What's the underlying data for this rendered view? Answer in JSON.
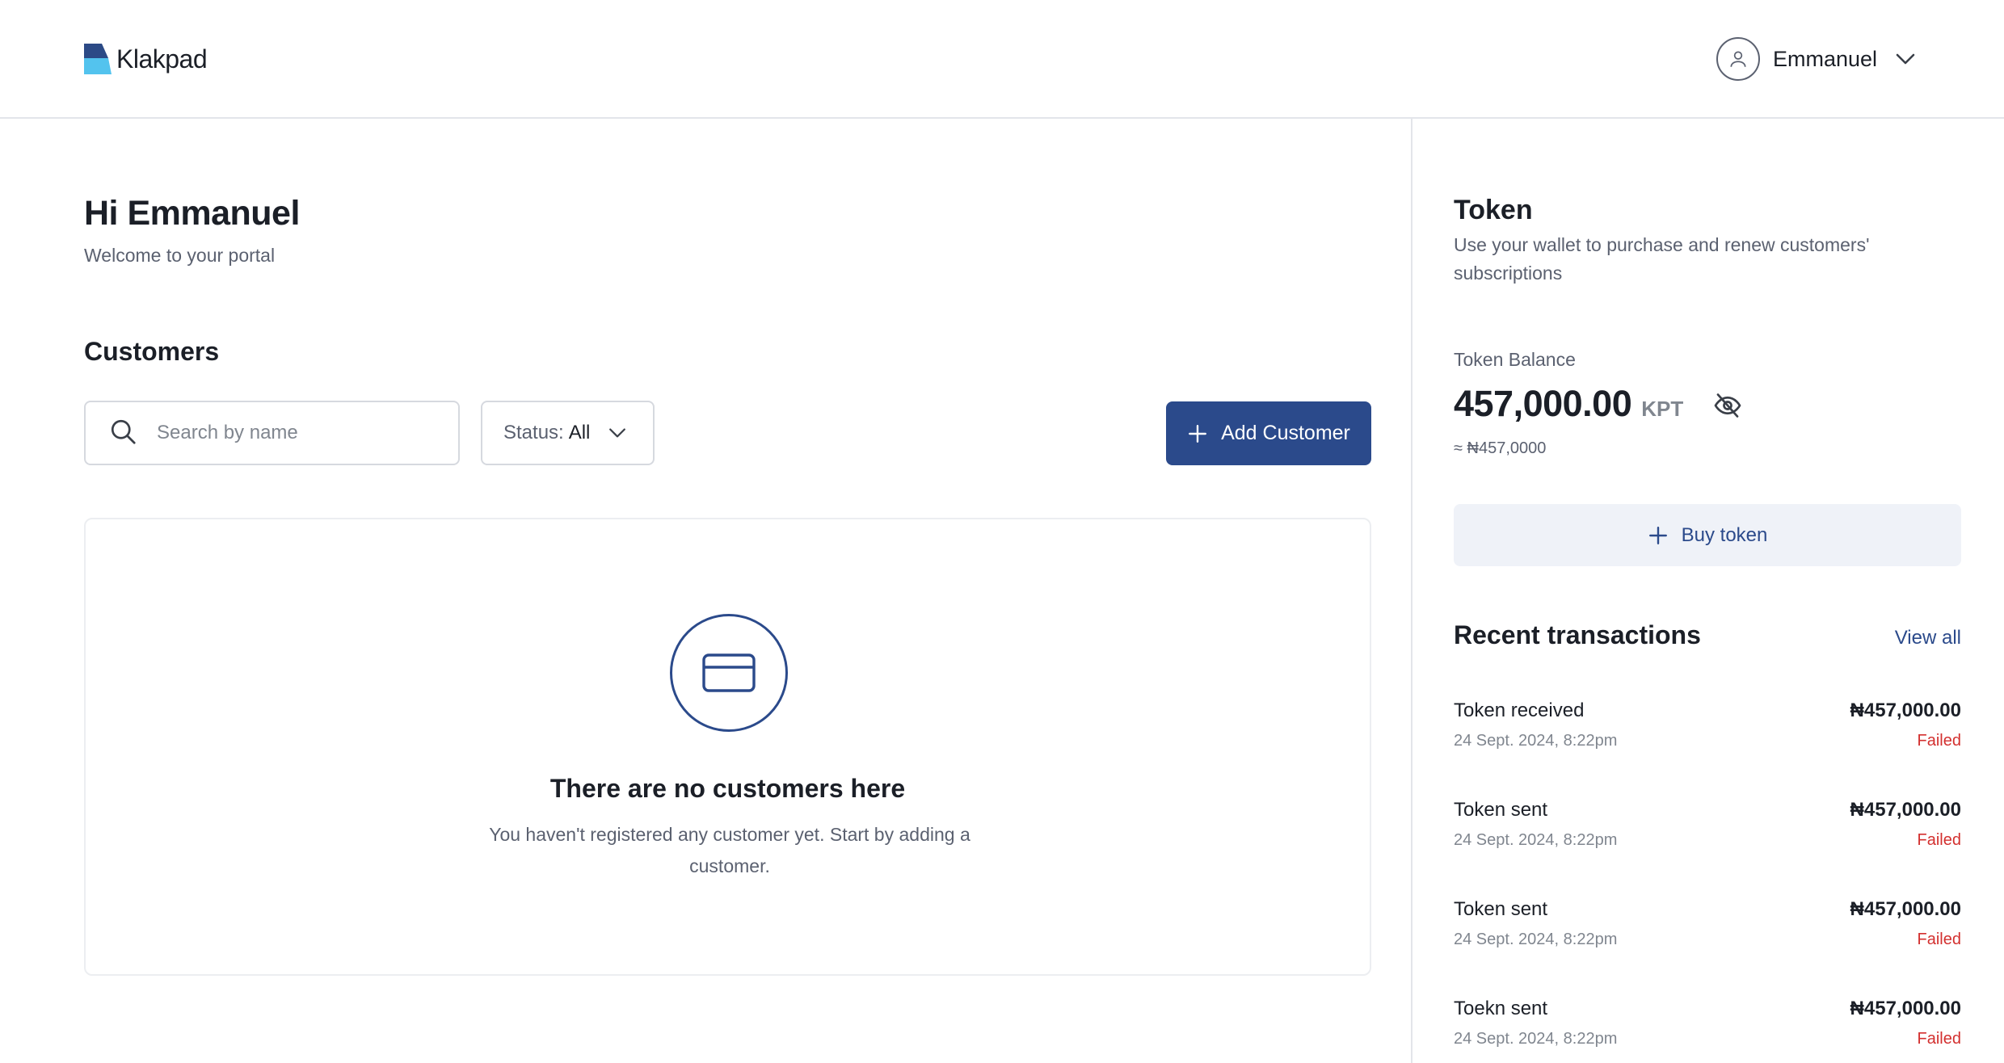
{
  "app": {
    "name": "Klakpad",
    "brand_colors": {
      "primary": "#2b4a8b",
      "logo_dark": "#2c4a86",
      "logo_light": "#53c3ee",
      "failed": "#d3302f"
    }
  },
  "header": {
    "user_name": "Emmanuel",
    "icons": [
      "user-icon",
      "chevron-down-icon"
    ]
  },
  "greeting": {
    "title": "Hi Emmanuel",
    "subtitle": "Welcome to your portal"
  },
  "customers": {
    "title": "Customers",
    "search_placeholder": "Search by name",
    "status_label": "Status:",
    "status_value": "All",
    "add_button_label": "Add Customer",
    "empty_state": {
      "icon": "credit-card-icon",
      "title": "There are no customers here",
      "text": "You haven't registered any customer yet. Start by adding a customer."
    }
  },
  "token": {
    "title": "Token",
    "subtitle": "Use your wallet to purchase and renew customers' subscriptions",
    "balance_label": "Token Balance",
    "balance_amount": "457,000.00",
    "balance_unit": "KPT",
    "balance_approx": "≈ ₦457,0000",
    "buy_button_label": "Buy token"
  },
  "transactions": {
    "title": "Recent transactions",
    "view_all_label": "View all",
    "items": [
      {
        "name": "Token received",
        "date": "24 Sept. 2024, 8:22pm",
        "amount": "₦457,000.00",
        "status": "Failed"
      },
      {
        "name": "Token sent",
        "date": "24 Sept. 2024, 8:22pm",
        "amount": "₦457,000.00",
        "status": "Failed"
      },
      {
        "name": "Token sent",
        "date": "24 Sept. 2024, 8:22pm",
        "amount": "₦457,000.00",
        "status": "Failed"
      },
      {
        "name": "Toekn sent",
        "date": "24 Sept. 2024, 8:22pm",
        "amount": "₦457,000.00",
        "status": "Failed"
      }
    ]
  }
}
